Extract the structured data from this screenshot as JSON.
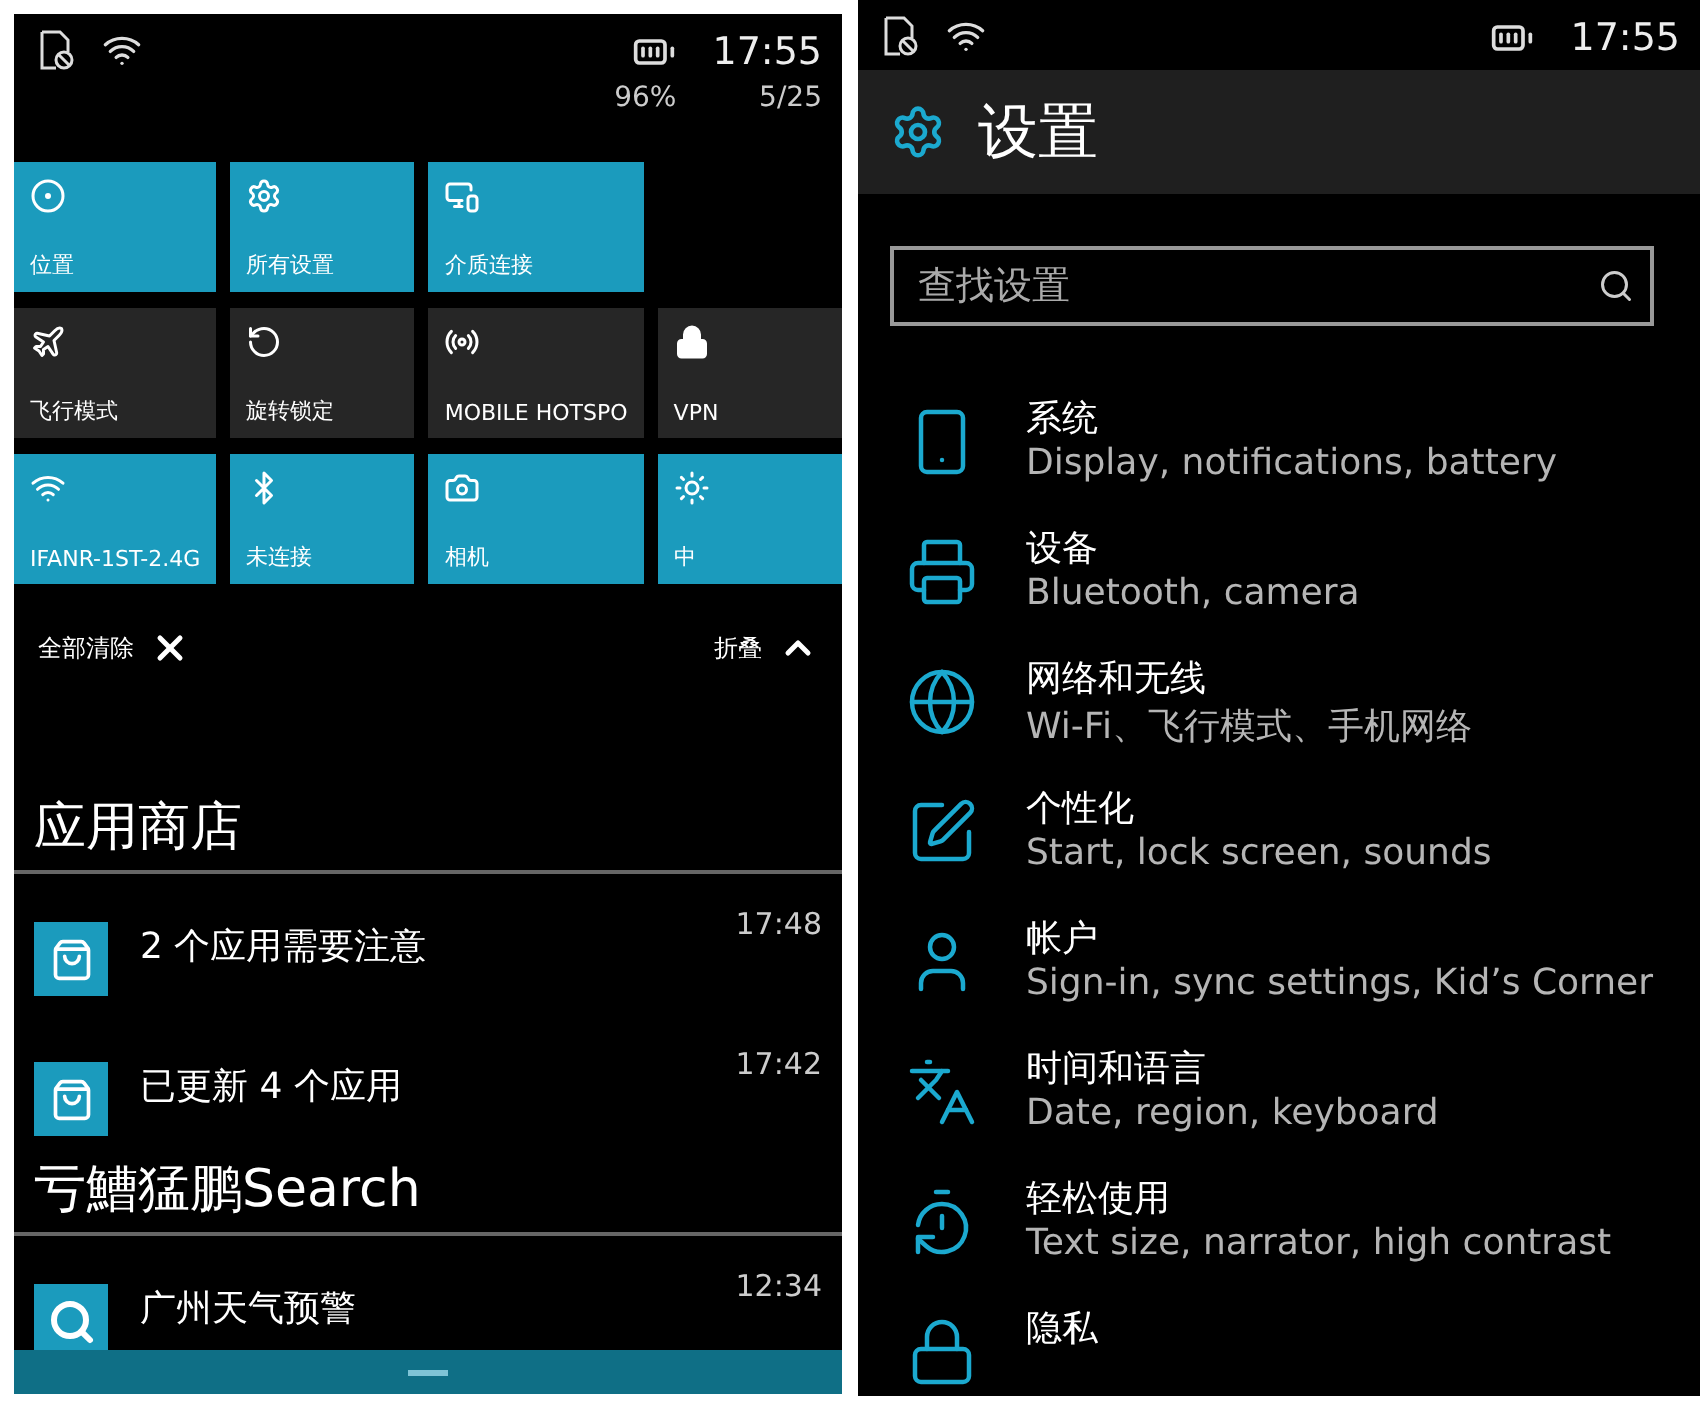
{
  "action_center": {
    "status_bar": {
      "time": "17:55",
      "battery": "96%",
      "date": "5/25"
    },
    "quick_actions": [
      [
        {
          "label": "位置",
          "on": true
        },
        {
          "label": "所有设置",
          "on": true
        },
        {
          "label": "介质连接",
          "on": true
        }
      ],
      [
        {
          "label": "飞行模式",
          "on": false
        },
        {
          "label": "旋转锁定",
          "on": false
        },
        {
          "label": "MOBILE HOTSPO",
          "on": false
        },
        {
          "label": "VPN",
          "on": false
        }
      ],
      [
        {
          "label": "IFANR-1ST-2.4G",
          "on": true
        },
        {
          "label": "未连接",
          "on": true
        },
        {
          "label": "相机",
          "on": true
        },
        {
          "label": "中",
          "on": true
        }
      ]
    ],
    "clear_all": "全部清除",
    "collapse": "折叠",
    "groups": [
      {
        "app": "应用商店",
        "items": [
          {
            "kind": "store",
            "title": "2 个应用需要注意",
            "time": "17:48"
          },
          {
            "kind": "store",
            "title": "已更新 4 个应用",
            "time": "17:42"
          }
        ]
      },
      {
        "app": "亏鰽猛鹏Search",
        "items": [
          {
            "kind": "search",
            "title": "广州天气预警",
            "time": "12:34"
          }
        ]
      }
    ]
  },
  "settings": {
    "status_bar": {
      "time": "17:55"
    },
    "title": "设置",
    "search": {
      "placeholder": "查找设置"
    },
    "items": [
      {
        "title": "系统",
        "subtitle": "Display, notifications, battery"
      },
      {
        "title": "设备",
        "subtitle": "Bluetooth, camera"
      },
      {
        "title": "网络和无线",
        "subtitle": "Wi-Fi、飞行模式、手机网络"
      },
      {
        "title": "个性化",
        "subtitle": "Start, lock screen, sounds"
      },
      {
        "title": "帐户",
        "subtitle": "Sign-in, sync settings, Kid’s Corner"
      },
      {
        "title": "时间和语言",
        "subtitle": "Date, region, keyboard"
      },
      {
        "title": "轻松使用",
        "subtitle": "Text size, narrator, high contrast"
      },
      {
        "title": "隐私"
      }
    ]
  }
}
